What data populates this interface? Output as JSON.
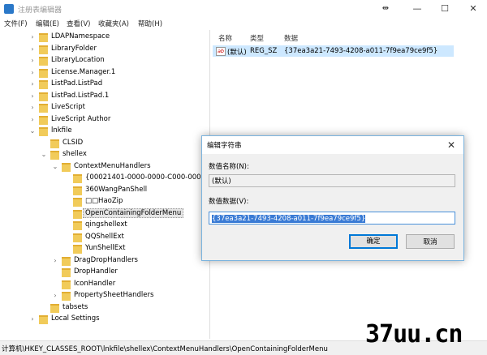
{
  "window": {
    "title": "注册表编辑器",
    "menu": [
      "文件(F)",
      "编辑(E)",
      "查看(V)",
      "收藏夹(A)",
      "帮助(H)"
    ]
  },
  "tree": {
    "items": [
      {
        "label": "LDAPNamespace",
        "depth": 2,
        "expander": "›"
      },
      {
        "label": "LibraryFolder",
        "depth": 2,
        "expander": "›"
      },
      {
        "label": "LibraryLocation",
        "depth": 2,
        "expander": "›"
      },
      {
        "label": "License.Manager.1",
        "depth": 2,
        "expander": "›"
      },
      {
        "label": "ListPad.ListPad",
        "depth": 2,
        "expander": "›"
      },
      {
        "label": "ListPad.ListPad.1",
        "depth": 2,
        "expander": "›"
      },
      {
        "label": "LiveScript",
        "depth": 2,
        "expander": "›"
      },
      {
        "label": "LiveScript Author",
        "depth": 2,
        "expander": "›"
      },
      {
        "label": "lnkfile",
        "depth": 2,
        "expander": "⌄"
      },
      {
        "label": "CLSID",
        "depth": 3,
        "expander": ""
      },
      {
        "label": "shellex",
        "depth": 3,
        "expander": "⌄"
      },
      {
        "label": "ContextMenuHandlers",
        "depth": 4,
        "expander": "⌄"
      },
      {
        "label": "{00021401-0000-0000-C000-000000000046}",
        "depth": 5,
        "expander": ""
      },
      {
        "label": "360WangPanShell",
        "depth": 5,
        "expander": ""
      },
      {
        "label": "□□HaoZip",
        "depth": 5,
        "expander": ""
      },
      {
        "label": "OpenContainingFolderMenu",
        "depth": 5,
        "expander": "",
        "selected": true
      },
      {
        "label": "qingshellext",
        "depth": 5,
        "expander": ""
      },
      {
        "label": "QQShellExt",
        "depth": 5,
        "expander": ""
      },
      {
        "label": "YunShellExt",
        "depth": 5,
        "expander": ""
      },
      {
        "label": "DragDropHandlers",
        "depth": 4,
        "expander": "›"
      },
      {
        "label": "DropHandler",
        "depth": 4,
        "expander": ""
      },
      {
        "label": "IconHandler",
        "depth": 4,
        "expander": ""
      },
      {
        "label": "PropertySheetHandlers",
        "depth": 4,
        "expander": "›"
      },
      {
        "label": "tabsets",
        "depth": 3,
        "expander": ""
      },
      {
        "label": "Local Settings",
        "depth": 2,
        "expander": "›"
      }
    ]
  },
  "list": {
    "columns": [
      "名称",
      "类型",
      "数据"
    ],
    "rows": [
      {
        "icon": "ab",
        "name": "(默认)",
        "type": "REG_SZ",
        "data": "{37ea3a21-7493-4208-a011-7f9ea79ce9f5}"
      }
    ]
  },
  "dialog": {
    "title": "编辑字符串",
    "name_label": "数值名称(N):",
    "name_value": "(默认)",
    "data_label": "数值数据(V):",
    "data_value": "{37ea3a21-7493-4208-a011-7f9ea79ce9f5}",
    "ok_label": "确定",
    "cancel_label": "取消"
  },
  "status": {
    "path": "计算机\\HKEY_CLASSES_ROOT\\lnkfile\\shellex\\ContextMenuHandlers\\OpenContainingFolderMenu"
  },
  "watermark": "37uu.cn"
}
